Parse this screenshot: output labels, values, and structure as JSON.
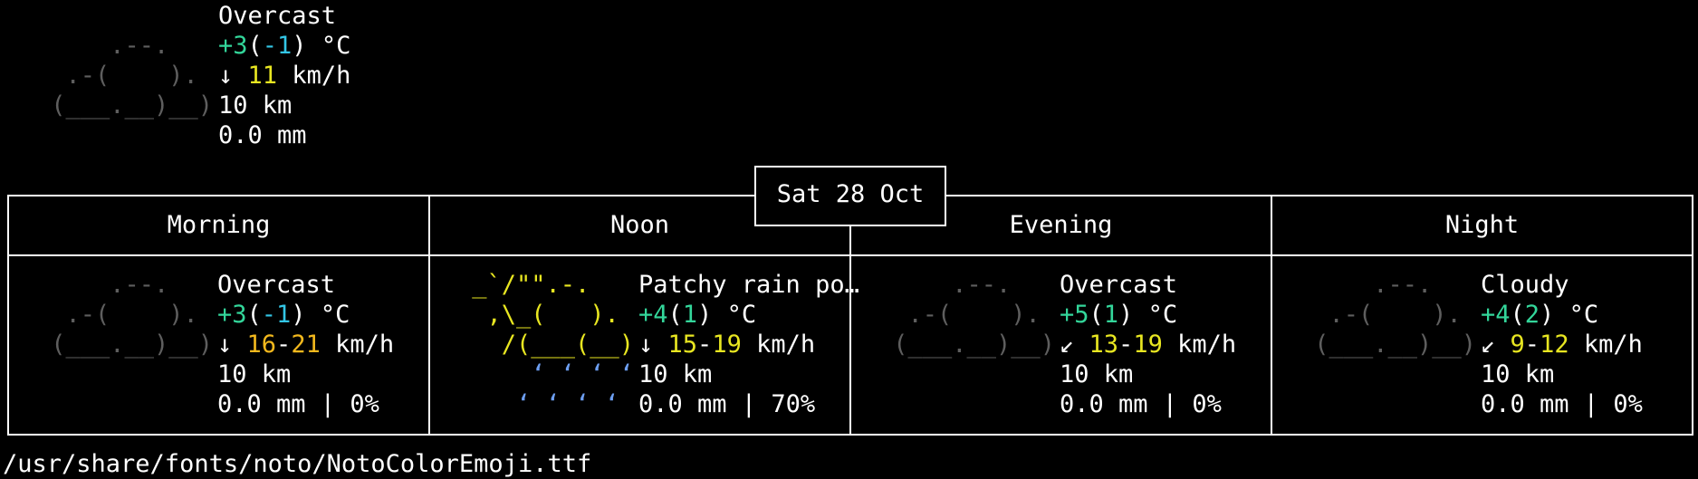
{
  "current": {
    "art": [
      "     .--.    ",
      "  .-(    ).  ",
      " (___.__)__) "
    ],
    "condition": "Overcast",
    "temp": "+3",
    "feels": "-1",
    "temp_unit": "°C",
    "wind_dir": "↓",
    "wind": "11",
    "wind_unit": "km/h",
    "visibility": "10 km",
    "precip": "0.0 mm"
  },
  "day": {
    "date_label": "Sat 28 Oct",
    "periods": [
      {
        "name": "Morning",
        "art": [
          "     .--.    ",
          "  .-(    ).  ",
          " (___.__)__) ",
          "             ",
          "             "
        ],
        "condition": "Overcast",
        "temp": "+3",
        "feels": "-1",
        "feels_color": "cyan",
        "temp_unit": "°C",
        "wind_dir": "↓",
        "wind_low": "16",
        "wind_high": "21",
        "wind_color": "gold",
        "wind_unit": "km/h",
        "visibility": "10 km",
        "precip": "0.0 mm",
        "chance": "0%"
      },
      {
        "name": "Noon",
        "art": [
          " _`/\"\".-.    ",
          "  ,\\_(   ).  ",
          "   /(___(__) ",
          "     ‘ ‘ ‘ ‘ ",
          "    ‘ ‘ ‘ ‘  "
        ],
        "condition": "Patchy rain po…",
        "temp": "+4",
        "feels": "1",
        "feels_color": "green",
        "temp_unit": "°C",
        "wind_dir": "↓",
        "wind_low": "15",
        "wind_high": "19",
        "wind_color": "yellow",
        "wind_unit": "km/h",
        "visibility": "10 km",
        "precip": "0.0 mm",
        "chance": "70%"
      },
      {
        "name": "Evening",
        "art": [
          "     .--.    ",
          "  .-(    ).  ",
          " (___.__)__) ",
          "             ",
          "             "
        ],
        "condition": "Overcast",
        "temp": "+5",
        "feels": "1",
        "feels_color": "green",
        "temp_unit": "°C",
        "wind_dir": "↙",
        "wind_low": "13",
        "wind_high": "19",
        "wind_color": "yellow",
        "wind_unit": "km/h",
        "visibility": "10 km",
        "precip": "0.0 mm",
        "chance": "0%"
      },
      {
        "name": "Night",
        "art": [
          "     .--.    ",
          "  .-(    ).  ",
          " (___.__)__) ",
          "             ",
          "             "
        ],
        "condition": "Cloudy",
        "temp": "+4",
        "feels": "2",
        "feels_color": "green",
        "temp_unit": "°C",
        "wind_dir": "↙",
        "wind_low": "9",
        "wind_high": "12",
        "wind_color": "yellow",
        "wind_unit": "km/h",
        "visibility": "10 km",
        "precip": "0.0 mm",
        "chance": "0%"
      }
    ]
  },
  "footer": {
    "path": "/usr/share/fonts/noto/NotoColorEmoji.ttf"
  },
  "colors": {
    "background": "#000000",
    "grey_art": "#5e5e5e",
    "green": "#33d69a",
    "cyan": "#33c6e6",
    "yellow": "#e8e621",
    "gold": "#f2b81d",
    "rain_blue": "#6d9ff2"
  }
}
